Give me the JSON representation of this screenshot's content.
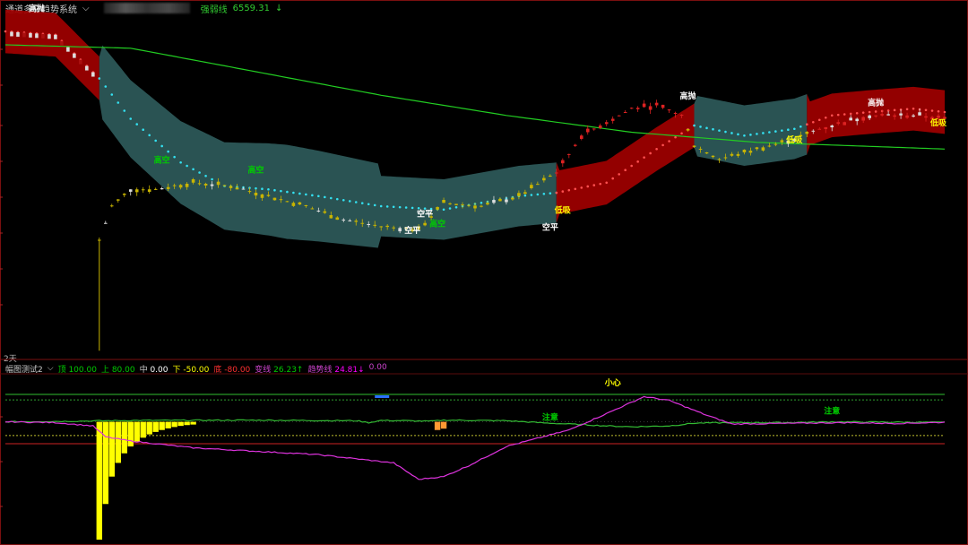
{
  "header": {
    "title": "通道多空趋势系统",
    "ma_label": "强弱线",
    "ma_value": "6559.31",
    "ma_arrow": "↓"
  },
  "period_label": "2天",
  "sub_header": {
    "title": "幅图测试2",
    "items": [
      {
        "label": "顶",
        "value": "100.00",
        "label_color": "#00cc00",
        "value_color": "#00cc00"
      },
      {
        "label": "上",
        "value": "80.00",
        "label_color": "#00cc00",
        "value_color": "#00cc00"
      },
      {
        "label": "中",
        "value": "0.00",
        "label_color": "#cccccc",
        "value_color": "#ffffff"
      },
      {
        "label": "下",
        "value": "-50.00",
        "label_color": "#ffff00",
        "value_color": "#ffff00"
      },
      {
        "label": "底",
        "value": "-80.00",
        "label_color": "#ff3030",
        "value_color": "#ff3030"
      },
      {
        "label": "变线",
        "value": "26.23",
        "arrow": "↑",
        "label_color": "#cc44cc",
        "value_color": "#00cc00"
      },
      {
        "label": "趋势线",
        "value": "24.81",
        "arrow": "↓",
        "label_color": "#cc44cc",
        "value_color": "#ff00ff"
      },
      {
        "label": "",
        "value": "0.00",
        "label_color": "#cc44cc",
        "value_color": "#cc44cc"
      }
    ]
  },
  "main_annotations": [
    {
      "text": "高抛",
      "color": "#ffffff"
    },
    {
      "text": "高空",
      "color": "#00cc00"
    },
    {
      "text": "高空",
      "color": "#00cc00"
    },
    {
      "text": "空平",
      "color": "#ffffff"
    },
    {
      "text": "空平",
      "color": "#ffffff"
    },
    {
      "text": "高空",
      "color": "#00cc00"
    },
    {
      "text": "空平",
      "color": "#ffffff"
    },
    {
      "text": "低吸",
      "color": "#ffff00"
    },
    {
      "text": "高抛",
      "color": "#ffffff"
    },
    {
      "text": "低吸",
      "color": "#ffff00"
    },
    {
      "text": "高抛",
      "color": "#ffffff"
    },
    {
      "text": "低吸",
      "color": "#ffff00"
    }
  ],
  "sub_annotations": [
    {
      "text": "小心",
      "color": "#ffff00"
    },
    {
      "text": "注意",
      "color": "#00cc00"
    },
    {
      "text": "注意",
      "color": "#00cc00"
    }
  ],
  "colors": {
    "up_channel": "#a00000",
    "down_channel": "#2e5a5a",
    "ma_line": "#22cc22",
    "candle_yellow": "#c8b400",
    "candle_red": "#dd2222",
    "candle_white": "#dddddd",
    "osc_green": "#33bb33",
    "osc_magenta": "#dd33dd",
    "hist_yellow": "#ffff00"
  },
  "chart_data": [
    {
      "type": "candlestick",
      "title": "通道多空趋势系统",
      "index": "x = bar number (0–150)",
      "channel_mid": [
        [
          0,
          96
        ],
        [
          8,
          95
        ],
        [
          15,
          82
        ],
        [
          20,
          70
        ],
        [
          28,
          57
        ],
        [
          35,
          50
        ],
        [
          42,
          49
        ],
        [
          50,
          47
        ],
        [
          60,
          44
        ],
        [
          70,
          43
        ],
        [
          82,
          47
        ],
        [
          88,
          48
        ],
        [
          96,
          51
        ],
        [
          104,
          61
        ],
        [
          110,
          68
        ],
        [
          118,
          65
        ],
        [
          126,
          67
        ],
        [
          132,
          71
        ],
        [
          138,
          72
        ],
        [
          145,
          73
        ],
        [
          150,
          72
        ]
      ],
      "channel_regimes": [
        {
          "from": 0,
          "to": 15,
          "state": "up"
        },
        {
          "from": 15,
          "to": 88,
          "state": "down"
        },
        {
          "from": 88,
          "to": 110,
          "state": "up"
        },
        {
          "from": 110,
          "to": 128,
          "state": "down"
        },
        {
          "from": 128,
          "to": 150,
          "state": "up"
        }
      ],
      "ma_line": [
        [
          0,
          92
        ],
        [
          20,
          91
        ],
        [
          40,
          84
        ],
        [
          60,
          77
        ],
        [
          80,
          71
        ],
        [
          100,
          66
        ],
        [
          120,
          63
        ],
        [
          150,
          61
        ]
      ],
      "price_trace": [
        [
          15,
          34
        ],
        [
          17,
          44
        ],
        [
          20,
          49
        ],
        [
          24,
          49
        ],
        [
          30,
          51
        ],
        [
          36,
          50
        ],
        [
          42,
          47
        ],
        [
          48,
          44
        ],
        [
          54,
          40
        ],
        [
          60,
          38
        ],
        [
          66,
          37
        ],
        [
          70,
          45
        ],
        [
          76,
          44
        ],
        [
          82,
          47
        ],
        [
          88,
          54
        ],
        [
          92,
          65
        ],
        [
          96,
          69
        ],
        [
          100,
          73
        ],
        [
          104,
          74
        ],
        [
          108,
          71
        ],
        [
          110,
          62
        ],
        [
          114,
          58
        ],
        [
          118,
          60
        ],
        [
          122,
          62
        ],
        [
          126,
          64
        ],
        [
          130,
          67
        ],
        [
          134,
          69
        ],
        [
          138,
          71
        ],
        [
          142,
          71
        ],
        [
          146,
          71
        ],
        [
          150,
          70
        ]
      ]
    },
    {
      "type": "line",
      "title": "幅图测试2",
      "reference_lines": {
        "顶": 100,
        "上": 80,
        "中": 0,
        "下": -50,
        "底": -80
      },
      "series": [
        {
          "name": "变线",
          "points": [
            [
              0,
              0
            ],
            [
              10,
              2
            ],
            [
              20,
              5
            ],
            [
              40,
              6
            ],
            [
              56,
              4
            ],
            [
              58,
              -3
            ],
            [
              60,
              5
            ],
            [
              64,
              4
            ],
            [
              68,
              2
            ],
            [
              70,
              6
            ],
            [
              80,
              4
            ],
            [
              86,
              -4
            ],
            [
              92,
              -10
            ],
            [
              96,
              -15
            ],
            [
              100,
              -18
            ],
            [
              106,
              -15
            ],
            [
              110,
              -5
            ],
            [
              116,
              -3
            ],
            [
              124,
              -3
            ],
            [
              132,
              0
            ],
            [
              140,
              -1
            ],
            [
              150,
              -2
            ]
          ]
        },
        {
          "name": "趋势线",
          "points": [
            [
              0,
              0
            ],
            [
              8,
              -3
            ],
            [
              14,
              -15
            ],
            [
              16,
              -55
            ],
            [
              20,
              -70
            ],
            [
              30,
              -95
            ],
            [
              50,
              -120
            ],
            [
              62,
              -150
            ],
            [
              66,
              -210
            ],
            [
              70,
              -200
            ],
            [
              74,
              -160
            ],
            [
              80,
              -90
            ],
            [
              90,
              -30
            ],
            [
              96,
              30
            ],
            [
              102,
              92
            ],
            [
              106,
              78
            ],
            [
              112,
              24
            ],
            [
              116,
              -8
            ],
            [
              124,
              -6
            ],
            [
              134,
              -3
            ],
            [
              142,
              -6
            ],
            [
              150,
              -2
            ]
          ]
        }
      ],
      "histogram": {
        "x": [
          15,
          16,
          17,
          18,
          19,
          20,
          21,
          22,
          23,
          24,
          25,
          26,
          27,
          28,
          29,
          30,
          69,
          70
        ],
        "values": [
          -430,
          -300,
          -200,
          -150,
          -115,
          -90,
          -72,
          -58,
          -46,
          -37,
          -30,
          -24,
          -19,
          -15,
          -12,
          -10,
          -30,
          -25
        ]
      }
    }
  ]
}
